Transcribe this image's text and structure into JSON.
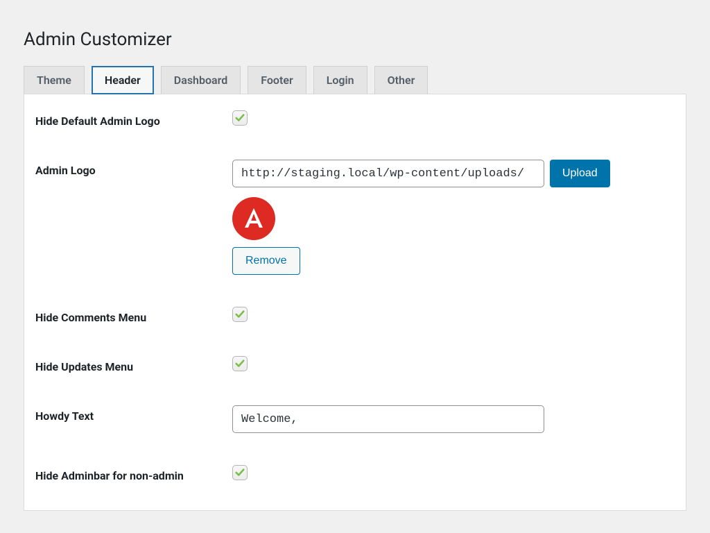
{
  "page": {
    "title": "Admin Customizer"
  },
  "tabs": {
    "items": [
      {
        "label": "Theme",
        "active": false
      },
      {
        "label": "Header",
        "active": true
      },
      {
        "label": "Dashboard",
        "active": false
      },
      {
        "label": "Footer",
        "active": false
      },
      {
        "label": "Login",
        "active": false
      },
      {
        "label": "Other",
        "active": false
      }
    ]
  },
  "form": {
    "hide_default_logo": {
      "label": "Hide Default Admin Logo",
      "checked": true
    },
    "admin_logo": {
      "label": "Admin Logo",
      "url_value": "http://staging.local/wp-content/uploads/",
      "upload_label": "Upload",
      "remove_label": "Remove",
      "preview_letter": "A"
    },
    "hide_comments": {
      "label": "Hide Comments Menu",
      "checked": true
    },
    "hide_updates": {
      "label": "Hide Updates Menu",
      "checked": true
    },
    "howdy_text": {
      "label": "Howdy Text",
      "value": "Welcome,"
    },
    "hide_adminbar": {
      "label": "Hide Adminbar for non-admin",
      "checked": true
    }
  }
}
